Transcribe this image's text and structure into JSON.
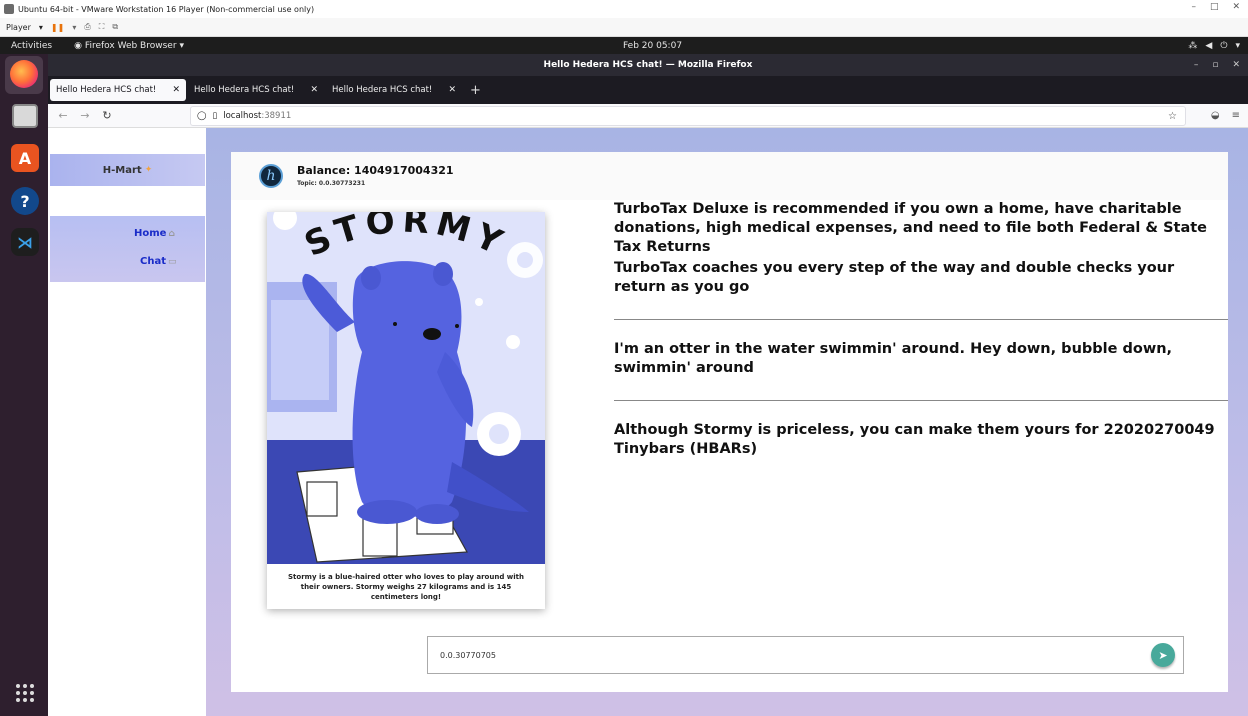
{
  "vm": {
    "title": "Ubuntu 64-bit - VMware Workstation 16 Player (Non-commercial use only)",
    "player_menu": "Player"
  },
  "gnome": {
    "activities": "Activities",
    "app_name": "Firefox Web Browser",
    "clock": "Feb 20  05:07"
  },
  "firefox": {
    "window_title": "Hello Hedera HCS chat! — Mozilla Firefox",
    "tabs": [
      {
        "label": "Hello Hedera HCS chat!"
      },
      {
        "label": "Hello Hedera HCS chat!"
      },
      {
        "label": "Hello Hedera HCS chat!"
      }
    ],
    "url_host": "localhost",
    "url_port": ":38911"
  },
  "sidebar": {
    "brand": "H-Mart",
    "nav": [
      {
        "label": "Home"
      },
      {
        "label": "Chat"
      }
    ]
  },
  "header": {
    "balance": "Balance: 1404917004321",
    "topic": "Topic: 0.0.30773231"
  },
  "nft": {
    "title": "STORMY",
    "caption": "Stormy is a blue-haired otter who loves to play around with their owners. Stormy weighs 27 kilograms and is 145 centimeters long!"
  },
  "messages": {
    "m1": "TurboTax Deluxe is recommended if you own a home, have charitable donations, high medical expenses, and need to file both Federal & State Tax Returns",
    "m2": "TurboTax coaches you every step of the way and double checks your return as you go",
    "m3": "I'm an otter in the water swimmin' around. Hey down, bubble down, swimmin' around",
    "m4": "Although Stormy is priceless, you can make them yours for 22020270049 Tinybars (HBARs)"
  },
  "composer": {
    "value": "0.0.30770705"
  },
  "colors": {
    "dock": "#2e1f2e",
    "page_gradient_top": "#a8b4e4",
    "send_button": "#48a99b",
    "nav_link": "#1a2cc8"
  },
  "icons": [
    "firefox-icon",
    "files-icon",
    "software-icon",
    "help-icon",
    "vscode-icon",
    "apps-grid-icon",
    "send-icon",
    "home-icon",
    "chat-icon",
    "star-icon"
  ]
}
